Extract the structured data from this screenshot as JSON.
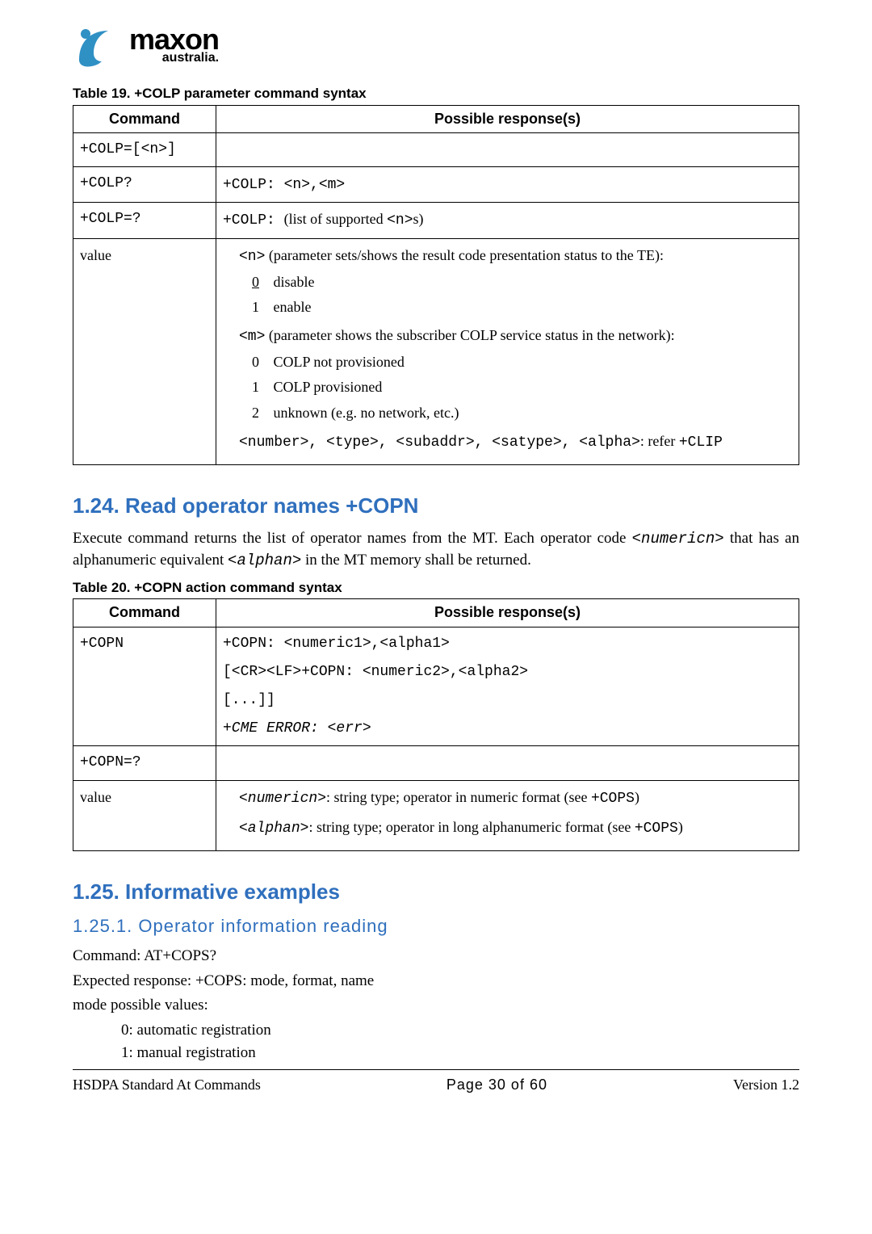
{
  "logo": {
    "brand": "maxon",
    "sub": "australia."
  },
  "table19": {
    "caption": "Table 19. +COLP parameter command syntax",
    "head_command": "Command",
    "head_response": "Possible response(s)",
    "rows": {
      "r1_cmd": "+COLP=[<n>]",
      "r1_resp": "",
      "r2_cmd": "+COLP?",
      "r2_resp_code": "+COLP: <n>,<m>",
      "r3_cmd": "+COLP=?",
      "r3_resp_code_pre": "+COLP: ",
      "r3_resp_text_mid": "(list of supported ",
      "r3_resp_code_mid": "<n>",
      "r3_resp_text_post": "s)",
      "val_label": "value",
      "n_desc_code": "<n>",
      "n_desc_text": " (parameter sets/shows the result code presentation status to the TE):",
      "n0_num": "0",
      "n0_text": "disable",
      "n1_num": "1",
      "n1_text": "enable",
      "m_desc_code": "<m>",
      "m_desc_text": " (parameter shows the subscriber COLP service status in the network):",
      "m0_num": "0",
      "m0_text": "COLP not provisioned",
      "m1_num": "1",
      "m1_text": "COLP provisioned",
      "m2_num": "2",
      "m2_text": "unknown (e.g. no network, etc.)",
      "refer_code": "<number>, <type>, <subaddr>, <satype>, <alpha>",
      "refer_text": ": refer ",
      "refer_clip": "+CLIP"
    }
  },
  "sec124": {
    "heading": "1.24.  Read operator names +COPN",
    "para_pre": "Execute command returns the list of operator names from the MT. Each operator code ",
    "para_code1": "<numericn>",
    "para_mid": " that has an alphanumeric equivalent ",
    "para_code2": "<alphan>",
    "para_post": " in the MT memory shall be returned."
  },
  "table20": {
    "caption": "Table 20. +COPN action command syntax",
    "head_command": "Command",
    "head_response": "Possible response(s)",
    "r1_cmd": "+COPN",
    "r1_l1": "+COPN: <numeric1>,<alpha1>",
    "r1_l2": "[<CR><LF>+COPN: <numeric2>,<alpha2>",
    "r1_l3": "[...]]",
    "r1_l4": "+CME ERROR: <err>",
    "r2_cmd": "+COPN=?",
    "r2_resp": "",
    "val_label": "value",
    "v1_code": "<numericn>",
    "v1_text": ": string type; operator in numeric format (see ",
    "v1_cops": "+COPS",
    "v1_close": ")",
    "v2_code": "<alphan>",
    "v2_text": ": string type; operator in long alphanumeric format (see ",
    "v2_cops": "+COPS",
    "v2_close": ")"
  },
  "sec125": {
    "heading": "1.25.  Informative examples",
    "sub_heading": "1.25.1.     Operator information reading",
    "l1": "Command: AT+COPS?",
    "l2": "Expected response: +COPS: mode, format, name",
    "l3": "mode possible values:",
    "m0": "0: automatic registration",
    "m1": "1: manual registration"
  },
  "footer": {
    "left": "HSDPA Standard At Commands",
    "center": "Page 30 of 60",
    "right": "Version 1.2"
  }
}
